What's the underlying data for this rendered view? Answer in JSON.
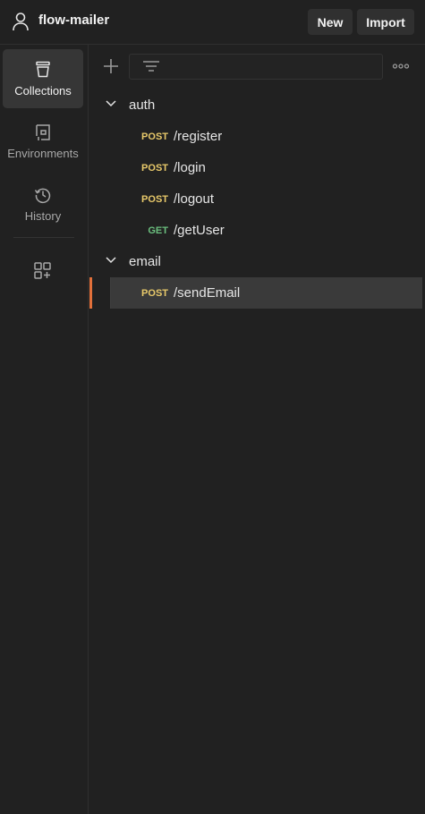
{
  "header": {
    "workspace_name": "flow-mailer",
    "new_label": "New",
    "import_label": "Import"
  },
  "sidebar": {
    "items": [
      {
        "label": "Collections",
        "icon": "collections-icon",
        "active": true
      },
      {
        "label": "Environments",
        "icon": "environments-icon",
        "active": false
      },
      {
        "label": "History",
        "icon": "history-icon",
        "active": false
      }
    ],
    "extra_icon": "configure-workbench-icon"
  },
  "toolbar": {
    "filter_placeholder": ""
  },
  "tree": {
    "folders": [
      {
        "name": "auth",
        "expanded": true,
        "requests": [
          {
            "method": "POST",
            "path": "/register"
          },
          {
            "method": "POST",
            "path": "/login"
          },
          {
            "method": "POST",
            "path": "/logout"
          },
          {
            "method": "GET",
            "path": "/getUser"
          }
        ]
      },
      {
        "name": "email",
        "expanded": true,
        "requests": [
          {
            "method": "POST",
            "path": "/sendEmail",
            "selected": true
          }
        ]
      }
    ]
  },
  "colors": {
    "background": "#212121",
    "post": "#e8c96a",
    "get": "#6bbf7e",
    "selected_accent": "#e2703a",
    "selected_bg": "#3a3a3a"
  }
}
